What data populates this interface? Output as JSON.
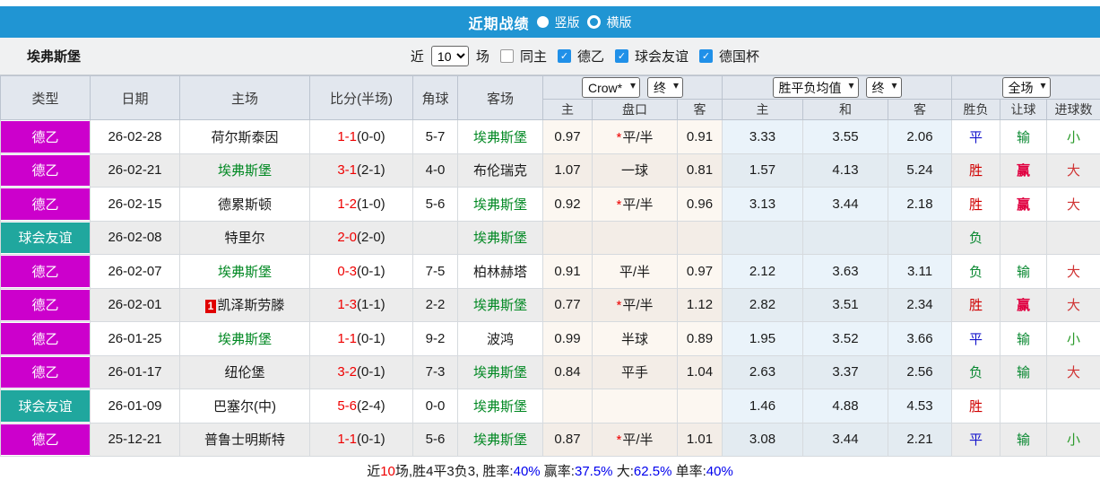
{
  "icons": {
    "check": "✓",
    "chevron_down": "▾"
  },
  "title_bar": {
    "bg": "#2095d3",
    "title": "近期战绩",
    "radios": [
      {
        "label": "竖版",
        "selected": true
      },
      {
        "label": "横版",
        "selected": false
      }
    ]
  },
  "filter_bar": {
    "team": "埃弗斯堡",
    "near_label": "近",
    "count_value": "10",
    "games_label": "场",
    "checkboxes": [
      {
        "label": "同主",
        "checked": false
      },
      {
        "label": "德乙",
        "checked": true
      },
      {
        "label": "球会友谊",
        "checked": true
      },
      {
        "label": "德国杯",
        "checked": true
      }
    ]
  },
  "table": {
    "static_headers": [
      "类型",
      "日期",
      "主场",
      "比分(半场)",
      "角球",
      "客场"
    ],
    "odds_group": {
      "select1": "Crow*",
      "select2": "终",
      "cols": [
        "主",
        "盘口",
        "客"
      ]
    },
    "avg_group": {
      "select1": "胜平负均值",
      "select2": "终",
      "cols": [
        "主",
        "和",
        "客"
      ]
    },
    "result_group": {
      "select": "全场",
      "cols": [
        "胜负",
        "让球",
        "进球数"
      ]
    },
    "type_colors": {
      "德乙": "#cc00cc",
      "球会友谊": "#20a79e"
    },
    "self_team_color": "#008822",
    "result_colors": {
      "胜": "#d00000",
      "平": "#1515cc",
      "负": "#088830",
      "输": "#088830",
      "赢": "#e00040",
      "大": "#d03333",
      "小": "#2a9a2a"
    },
    "matches": [
      {
        "type": "德乙",
        "date": "26-02-28",
        "home": "荷尔斯泰因",
        "home_self": false,
        "home_badge": "",
        "score": "1-1",
        "half": "(0-0)",
        "corners": "5-7",
        "away": "埃弗斯堡",
        "away_self": true,
        "o1": "0.97",
        "hcap": "平/半",
        "hcap_star": true,
        "o2": "0.91",
        "m1": "3.33",
        "m2": "3.55",
        "m3": "2.06",
        "spf": "平",
        "rq": "输",
        "jq": "小"
      },
      {
        "type": "德乙",
        "date": "26-02-21",
        "home": "埃弗斯堡",
        "home_self": true,
        "home_badge": "",
        "score": "3-1",
        "half": "(2-1)",
        "corners": "4-0",
        "away": "布伦瑞克",
        "away_self": false,
        "o1": "1.07",
        "hcap": "一球",
        "hcap_star": false,
        "o2": "0.81",
        "m1": "1.57",
        "m2": "4.13",
        "m3": "5.24",
        "spf": "胜",
        "rq": "赢",
        "jq": "大"
      },
      {
        "type": "德乙",
        "date": "26-02-15",
        "home": "德累斯顿",
        "home_self": false,
        "home_badge": "",
        "score": "1-2",
        "half": "(1-0)",
        "corners": "5-6",
        "away": "埃弗斯堡",
        "away_self": true,
        "o1": "0.92",
        "hcap": "平/半",
        "hcap_star": true,
        "o2": "0.96",
        "m1": "3.13",
        "m2": "3.44",
        "m3": "2.18",
        "spf": "胜",
        "rq": "赢",
        "jq": "大"
      },
      {
        "type": "球会友谊",
        "date": "26-02-08",
        "home": "特里尔",
        "home_self": false,
        "home_badge": "",
        "score": "2-0",
        "half": "(2-0)",
        "corners": "",
        "away": "埃弗斯堡",
        "away_self": true,
        "o1": "",
        "hcap": "",
        "hcap_star": false,
        "o2": "",
        "m1": "",
        "m2": "",
        "m3": "",
        "spf": "负",
        "rq": "",
        "jq": ""
      },
      {
        "type": "德乙",
        "date": "26-02-07",
        "home": "埃弗斯堡",
        "home_self": true,
        "home_badge": "",
        "score": "0-3",
        "half": "(0-1)",
        "corners": "7-5",
        "away": "柏林赫塔",
        "away_self": false,
        "o1": "0.91",
        "hcap": "平/半",
        "hcap_star": false,
        "o2": "0.97",
        "m1": "2.12",
        "m2": "3.63",
        "m3": "3.11",
        "spf": "负",
        "rq": "输",
        "jq": "大"
      },
      {
        "type": "德乙",
        "date": "26-02-01",
        "home": "凯泽斯劳滕",
        "home_self": false,
        "home_badge": "1",
        "score": "1-3",
        "half": "(1-1)",
        "corners": "2-2",
        "away": "埃弗斯堡",
        "away_self": true,
        "o1": "0.77",
        "hcap": "平/半",
        "hcap_star": true,
        "o2": "1.12",
        "m1": "2.82",
        "m2": "3.51",
        "m3": "2.34",
        "spf": "胜",
        "rq": "赢",
        "jq": "大"
      },
      {
        "type": "德乙",
        "date": "26-01-25",
        "home": "埃弗斯堡",
        "home_self": true,
        "home_badge": "",
        "score": "1-1",
        "half": "(0-1)",
        "corners": "9-2",
        "away": "波鸿",
        "away_self": false,
        "o1": "0.99",
        "hcap": "半球",
        "hcap_star": false,
        "o2": "0.89",
        "m1": "1.95",
        "m2": "3.52",
        "m3": "3.66",
        "spf": "平",
        "rq": "输",
        "jq": "小"
      },
      {
        "type": "德乙",
        "date": "26-01-17",
        "home": "纽伦堡",
        "home_self": false,
        "home_badge": "",
        "score": "3-2",
        "half": "(0-1)",
        "corners": "7-3",
        "away": "埃弗斯堡",
        "away_self": true,
        "o1": "0.84",
        "hcap": "平手",
        "hcap_star": false,
        "o2": "1.04",
        "m1": "2.63",
        "m2": "3.37",
        "m3": "2.56",
        "spf": "负",
        "rq": "输",
        "jq": "大"
      },
      {
        "type": "球会友谊",
        "date": "26-01-09",
        "home": "巴塞尔(中)",
        "home_self": false,
        "home_badge": "",
        "score": "5-6",
        "half": "(2-4)",
        "corners": "0-0",
        "away": "埃弗斯堡",
        "away_self": true,
        "o1": "",
        "hcap": "",
        "hcap_star": false,
        "o2": "",
        "m1": "1.46",
        "m2": "4.88",
        "m3": "4.53",
        "spf": "胜",
        "rq": "",
        "jq": ""
      },
      {
        "type": "德乙",
        "date": "25-12-21",
        "home": "普鲁士明斯特",
        "home_self": false,
        "home_badge": "",
        "score": "1-1",
        "half": "(0-1)",
        "corners": "5-6",
        "away": "埃弗斯堡",
        "away_self": true,
        "o1": "0.87",
        "hcap": "平/半",
        "hcap_star": true,
        "o2": "1.01",
        "m1": "3.08",
        "m2": "3.44",
        "m3": "2.21",
        "spf": "平",
        "rq": "输",
        "jq": "小"
      }
    ]
  },
  "summary": {
    "segments": [
      {
        "t": "近",
        "c": "k"
      },
      {
        "t": "10",
        "c": "r"
      },
      {
        "t": "场,胜4平3负3, 胜率:",
        "c": "k"
      },
      {
        "t": "40%",
        "c": "b"
      },
      {
        "t": " 赢率:",
        "c": "k"
      },
      {
        "t": "37.5%",
        "c": "b"
      },
      {
        "t": " 大:",
        "c": "k"
      },
      {
        "t": "62.5%",
        "c": "b"
      },
      {
        "t": " 单率:",
        "c": "k"
      },
      {
        "t": "40%",
        "c": "b"
      }
    ]
  }
}
